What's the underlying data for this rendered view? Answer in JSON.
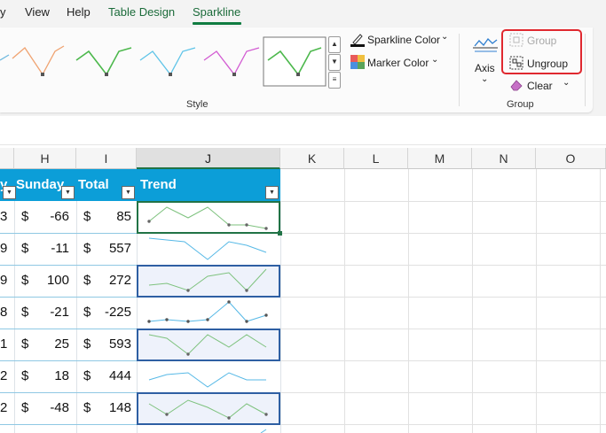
{
  "menu": {
    "tabs": [
      "y",
      "View",
      "Help",
      "Table Design",
      "Sparkline"
    ]
  },
  "ribbon": {
    "style_group_label": "Style",
    "sparkline_color_label": "Sparkline Color",
    "marker_color_label": "Marker Color",
    "axis_label": "Axis",
    "group_button_label": "Group",
    "ungroup_button_label": "Ungroup",
    "clear_button_label": "Clear",
    "group_group_label": "Group",
    "accent_color": "#107c41",
    "highlight_color": "#e0282f"
  },
  "grid": {
    "columns": [
      "H",
      "I",
      "J",
      "K",
      "L",
      "M",
      "N",
      "O"
    ],
    "headers": {
      "partial": "y",
      "sunday": "Sunday",
      "total": "Total",
      "trend": "Trend"
    },
    "rows": [
      {
        "g": "3",
        "cur1": "$",
        "sunday": "-66",
        "cur2": "$",
        "total": "85"
      },
      {
        "g": "9",
        "cur1": "$",
        "sunday": "-11",
        "cur2": "$",
        "total": "557"
      },
      {
        "g": "9",
        "cur1": "$",
        "sunday": "100",
        "cur2": "$",
        "total": "272"
      },
      {
        "g": "8",
        "cur1": "$",
        "sunday": "-21",
        "cur2": "$",
        "total": "-225"
      },
      {
        "g": "1",
        "cur1": "$",
        "sunday": "25",
        "cur2": "$",
        "total": "593"
      },
      {
        "g": "2",
        "cur1": "$",
        "sunday": "18",
        "cur2": "$",
        "total": "444"
      },
      {
        "g": "2",
        "cur1": "$",
        "sunday": "-48",
        "cur2": "$",
        "total": "148"
      }
    ],
    "header_color": "#0c9ed8",
    "sparkline_green": "#7ec27e",
    "sparkline_blue": "#57b9e6"
  }
}
